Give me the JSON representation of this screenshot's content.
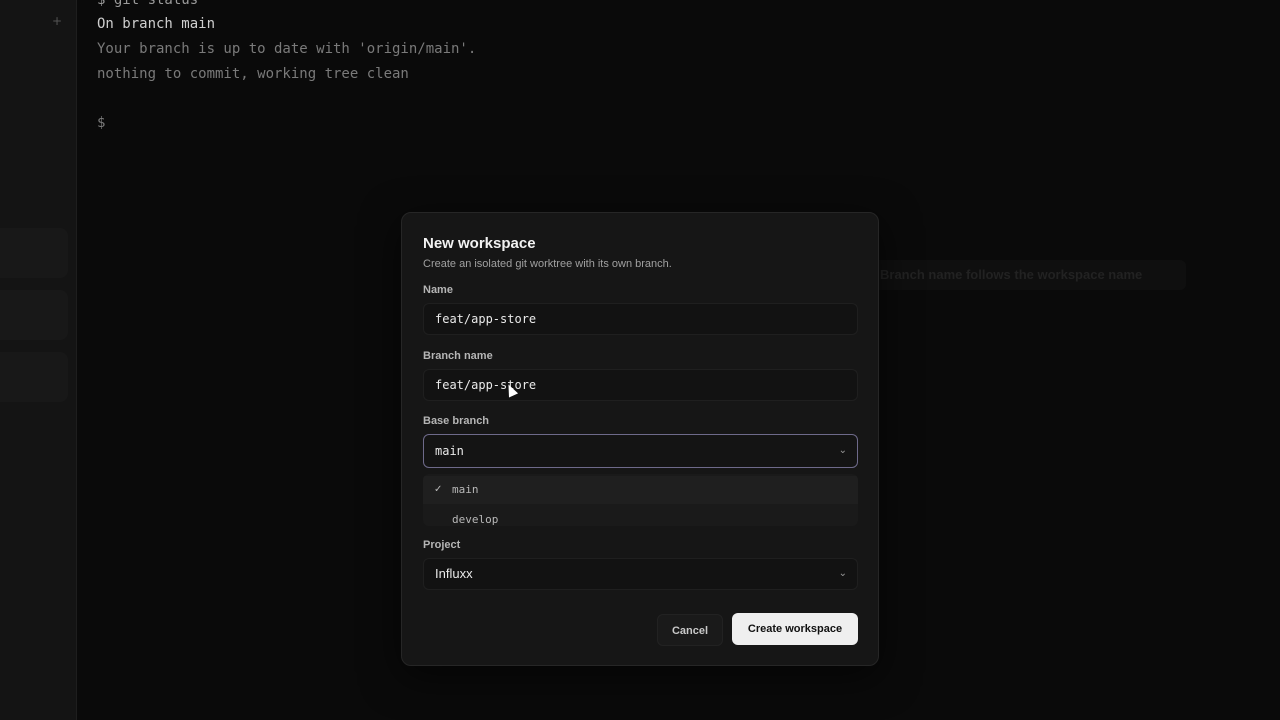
{
  "sidebar": {
    "add_icon": "+"
  },
  "terminal": {
    "lines": {
      "cmd": "$ git status",
      "branch": "On branch main",
      "uptodate": "Your branch is up to date with 'origin/main'.",
      "clean": "nothing to commit, working tree clean",
      "prompt": "$"
    }
  },
  "tooltip": {
    "text": "Branch name follows the workspace name"
  },
  "dialog": {
    "title": "New workspace",
    "subtitle": "Create an isolated git worktree with its own branch.",
    "name": {
      "label": "Name",
      "value": "feat/app-store"
    },
    "branch": {
      "label": "Branch name",
      "value": "feat/app-store"
    },
    "base": {
      "label": "Base branch",
      "value": "main",
      "options": [
        "main",
        "develop"
      ],
      "selected_mark": "✓"
    },
    "project": {
      "label": "Project",
      "value": "Influxx"
    },
    "chevron": "⌄",
    "cancel_label": "Cancel",
    "create_label": "Create workspace"
  },
  "colors": {
    "focus_border": "#6e6a8a",
    "primary_button": "#efefef"
  }
}
